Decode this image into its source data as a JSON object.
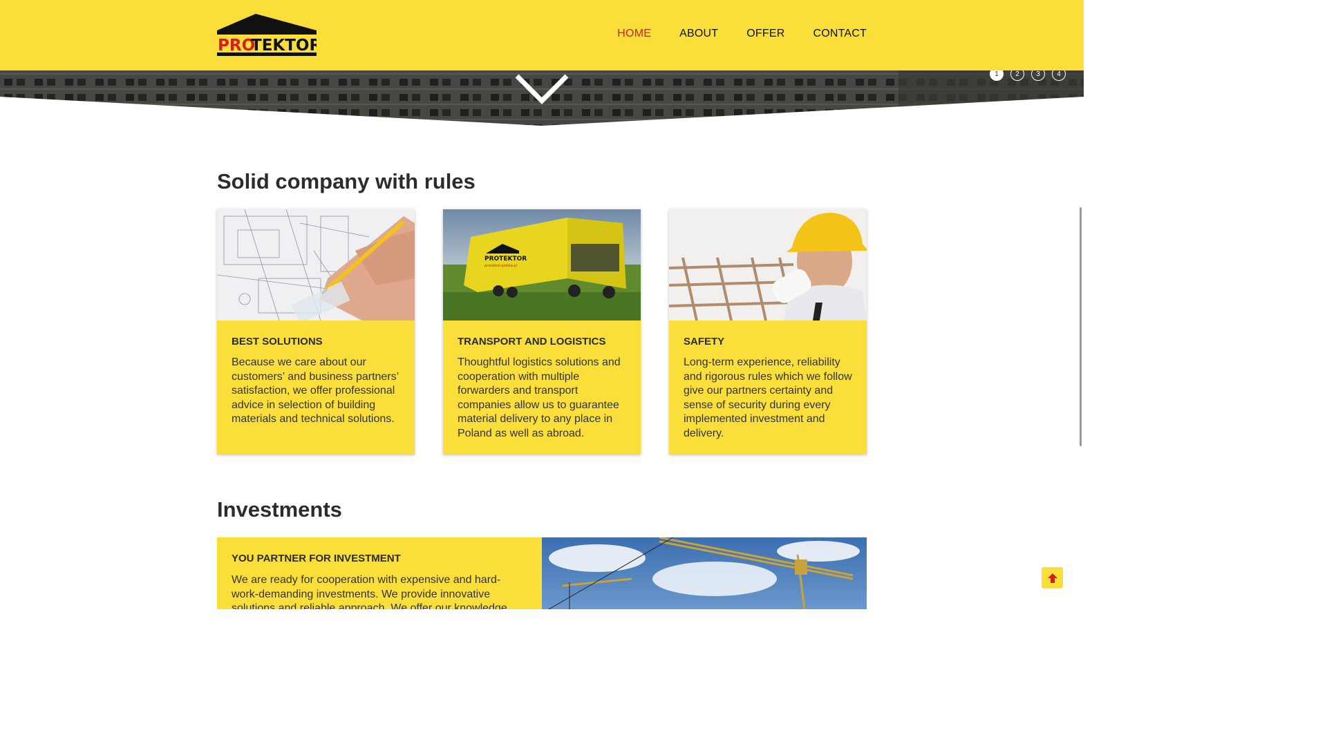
{
  "header": {
    "logo_text_pro": "PRO",
    "logo_text_tektor": "TEKTOR",
    "nav": [
      {
        "label": "HOME",
        "active": true
      },
      {
        "label": "ABOUT",
        "active": false
      },
      {
        "label": "OFFER",
        "active": false
      },
      {
        "label": "CONTACT",
        "active": false
      }
    ]
  },
  "slider": {
    "dots": [
      "1",
      "2",
      "3",
      "4"
    ],
    "active": "1"
  },
  "section1": {
    "title": "Solid company with rules",
    "cards": [
      {
        "title": "BEST SOLUTIONS",
        "text": "Because we care about our customers’ and business partners’ satisfaction, we offer professional advice in selection of building materials and technical solutions.",
        "image": "blueprint-drawing-photo"
      },
      {
        "title": "TRANSPORT AND LOGISTICS",
        "text": "Thoughtful logistics solutions and cooperation with multiple forwarders and transport companies allow us to guarantee material delivery to any place in Poland as well as abroad.",
        "image": "protektor-truck-photo",
        "truck_brand": "PROTEKTOR",
        "truck_site": "protektor-polska.pl"
      },
      {
        "title": "SAFETY",
        "text": "Long-term experience, reliability and rigorous rules which we follow give our partners certainty and sense of security during every implemented investment and delivery.",
        "image": "engineer-hardhat-photo"
      }
    ]
  },
  "section2": {
    "title": "Investments",
    "block_title": "YOU PARTNER FOR INVESTMENT",
    "block_text": "We are ready for cooperation with expensive and hard-work-demanding investments. We provide innovative solutions and reliable approach. We offer our knowledge",
    "image": "construction-cranes-photo"
  },
  "icons": {
    "scroll_down": "chevron-down-icon",
    "scroll_top": "arrow-up-icon"
  },
  "colors": {
    "brand_yellow": "#fadf3a",
    "nav_active": "#d2211c",
    "logo_red": "#d2211c",
    "text_dark": "#2b2b2b"
  }
}
